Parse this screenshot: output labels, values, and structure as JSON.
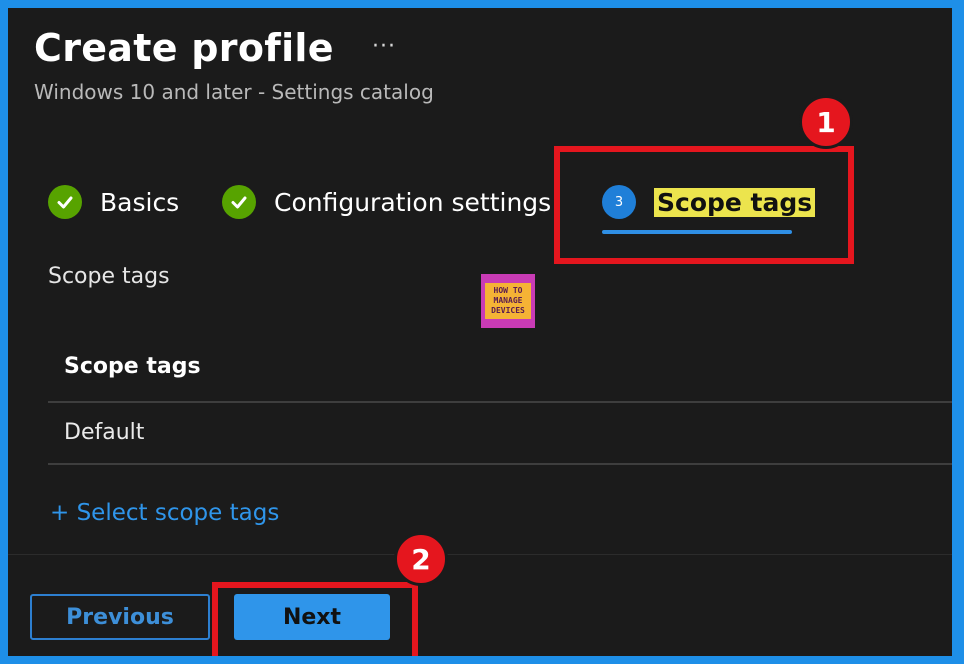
{
  "header": {
    "title": "Create profile",
    "more": "···",
    "subtitle": "Windows 10 and later - Settings catalog"
  },
  "steps": [
    {
      "label": "Basics",
      "status": "complete"
    },
    {
      "label": "Configuration settings",
      "status": "complete"
    },
    {
      "number": "3",
      "label": "Scope tags",
      "status": "active"
    }
  ],
  "annotations": {
    "badge_1": "1",
    "badge_2": "2"
  },
  "section": {
    "label": "Scope tags"
  },
  "logo": {
    "line1": "HOW TO",
    "line2": "MANAGE",
    "line3": "DEVICES"
  },
  "table": {
    "header": "Scope tags",
    "rows": [
      "Default"
    ]
  },
  "select_link": "+ Select scope tags",
  "footer": {
    "previous_label": "Previous",
    "next_label": "Next"
  },
  "colors": {
    "accent": "#2f95ea",
    "success": "#57a300",
    "annotation_red": "#e5161e",
    "highlight": "#ece44d"
  }
}
